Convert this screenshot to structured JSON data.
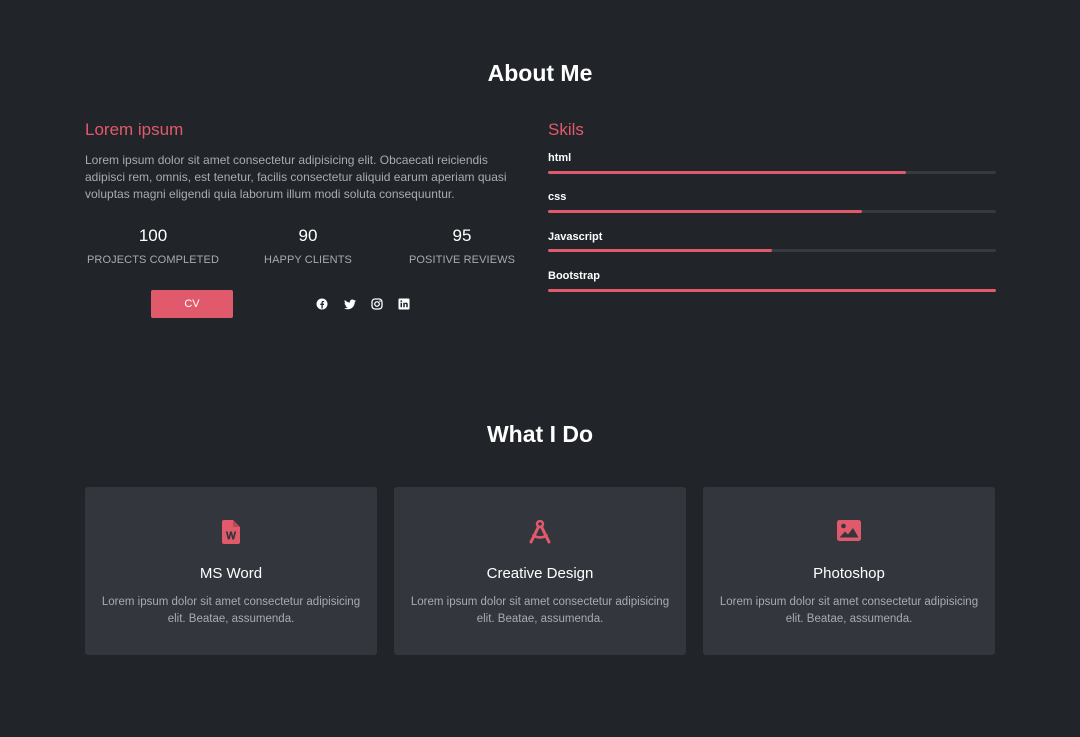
{
  "about": {
    "title": "About Me",
    "heading": "Lorem ipsum",
    "text": "Lorem ipsum dolor sit amet consectetur adipisicing elit. Obcaecati reiciendis adipisci rem, omnis, est tenetur, facilis consectetur aliquid earum aperiam quasi voluptas magni eligendi quia laborum illum modi soluta consequuntur.",
    "stats": [
      {
        "value": "100",
        "label": "PROJECTS COMPLETED"
      },
      {
        "value": "90",
        "label": "HAPPY CLIENTS"
      },
      {
        "value": "95",
        "label": "POSITIVE REVIEWS"
      }
    ],
    "cv_label": "CV",
    "social_icons": [
      "facebook-icon",
      "twitter-icon",
      "instagram-icon",
      "linkedin-icon"
    ]
  },
  "skills": {
    "heading": "Skils",
    "items": [
      {
        "name": "html",
        "percent": 80
      },
      {
        "name": "css",
        "percent": 70
      },
      {
        "name": "Javascript",
        "percent": 50
      },
      {
        "name": "Bootstrap",
        "percent": 100
      }
    ]
  },
  "services": {
    "title": "What I Do",
    "cards": [
      {
        "icon": "word-file-icon",
        "title": "MS Word",
        "text": "Lorem ipsum dolor sit amet consectetur adipisicing elit. Beatae, assumenda."
      },
      {
        "icon": "compass-icon",
        "title": "Creative Design",
        "text": "Lorem ipsum dolor sit amet consectetur adipisicing elit. Beatae, assumenda."
      },
      {
        "icon": "image-icon",
        "title": "Photoshop",
        "text": "Lorem ipsum dolor sit amet consectetur adipisicing elit. Beatae, assumenda."
      }
    ]
  },
  "colors": {
    "background": "#212429",
    "accent": "#e05a6b",
    "card": "#33363c",
    "muted_text": "#a7abb2"
  }
}
